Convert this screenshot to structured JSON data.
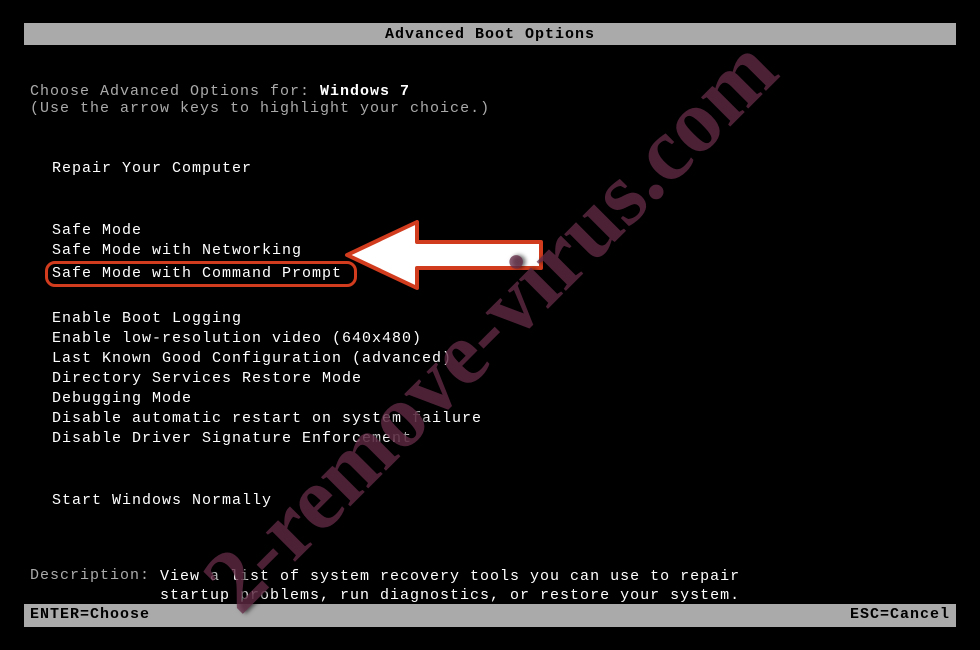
{
  "title": "Advanced Boot Options",
  "intro_prefix": "Choose Advanced Options for: ",
  "os_name": "Windows 7",
  "hint": "(Use the arrow keys to highlight your choice.)",
  "group1": [
    "Repair Your Computer"
  ],
  "group2": [
    "Safe Mode",
    "Safe Mode with Networking",
    "Safe Mode with Command Prompt"
  ],
  "group3": [
    "Enable Boot Logging",
    "Enable low-resolution video (640x480)",
    "Last Known Good Configuration (advanced)",
    "Directory Services Restore Mode",
    "Debugging Mode",
    "Disable automatic restart on system failure",
    "Disable Driver Signature Enforcement"
  ],
  "group4": [
    "Start Windows Normally"
  ],
  "highlighted_item": "Safe Mode with Command Prompt",
  "desc_label": "Description:",
  "desc_line1": "View a list of system recovery tools you can use to repair",
  "desc_line2": "startup problems, run diagnostics, or restore your system.",
  "footer_left": "ENTER=Choose",
  "footer_right": "ESC=Cancel",
  "watermark": "2-remove-virus.com"
}
